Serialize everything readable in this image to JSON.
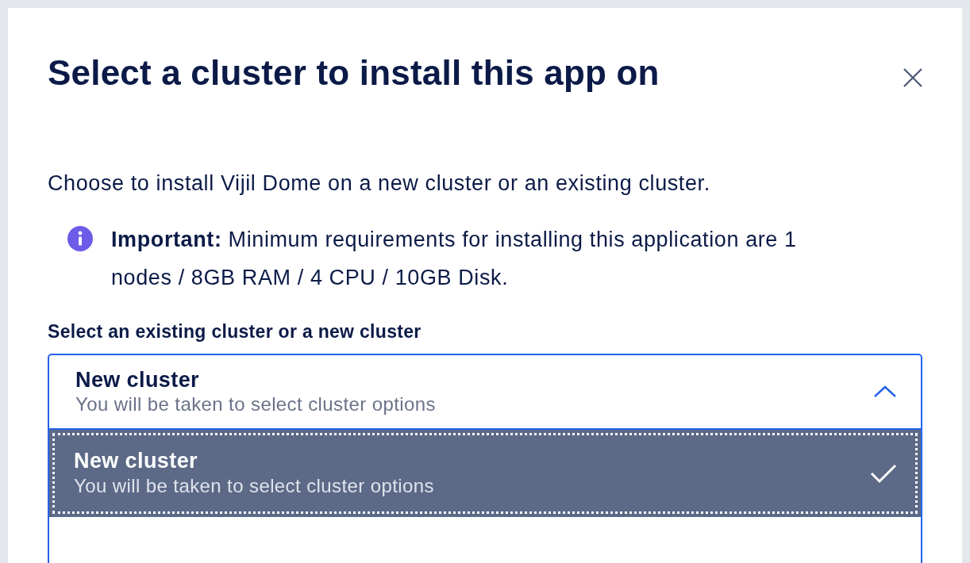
{
  "dialog": {
    "title": "Select a cluster to install this app on",
    "description": "Choose to install Vijil Dome on a new cluster or an existing cluster.",
    "notice": {
      "text": "**Important:** Minimum requirements for installing this application are 1 nodes / 8GB RAM / 4 CPU / 10GB Disk."
    },
    "select": {
      "label": "Select an existing cluster or a new cluster",
      "expanded": true,
      "value": {
        "title": "New cluster",
        "subtitle": "You will be taken to select cluster options"
      },
      "options": [
        {
          "title": "New cluster",
          "subtitle": "You will be taken to select cluster options",
          "selected": true
        }
      ]
    }
  }
}
